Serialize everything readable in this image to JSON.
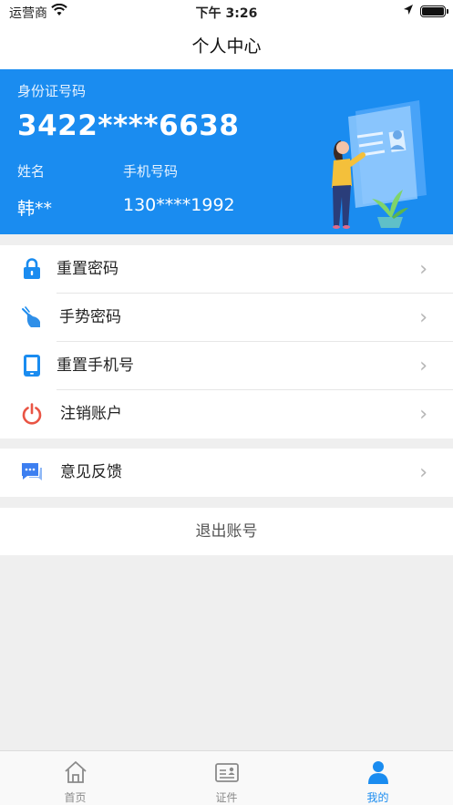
{
  "status_bar": {
    "carrier": "运营商",
    "time": "下午 3:26"
  },
  "nav": {
    "title": "个人中心"
  },
  "profile_card": {
    "id_label": "身份证号码",
    "id_number": "3422****6638",
    "name_label": "姓名",
    "name_value": "韩**",
    "phone_label": "手机号码",
    "phone_value": "130****1992",
    "accent_color": "#1a8cf0"
  },
  "menu": {
    "items": [
      {
        "label": "重置密码",
        "icon": "lock-icon"
      },
      {
        "label": "手势密码",
        "icon": "gesture-hand-icon"
      },
      {
        "label": "重置手机号",
        "icon": "phone-icon"
      },
      {
        "label": "注销账户",
        "icon": "power-icon"
      }
    ],
    "feedback": {
      "label": "意见反馈",
      "icon": "chat-bubble-icon"
    },
    "logout_label": "退出账号"
  },
  "tabbar": {
    "tabs": [
      {
        "label": "首页",
        "icon": "home-icon",
        "active": false
      },
      {
        "label": "证件",
        "icon": "id-card-icon",
        "active": false
      },
      {
        "label": "我的",
        "icon": "user-icon",
        "active": true
      }
    ]
  }
}
